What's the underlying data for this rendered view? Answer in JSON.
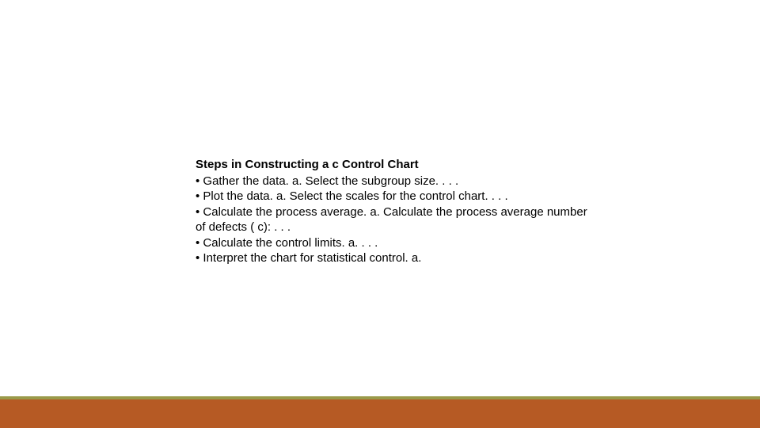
{
  "slide": {
    "title": "Steps in Constructing a c Control Chart",
    "bullets": [
      " • Gather the data. a. Select the subgroup size. . . .",
      " • Plot the data. a. Select the scales for the control chart. . . .",
      " • Calculate the process average. a. Calculate the process average number of defects ( c): . . .",
      " • Calculate the control limits. a. . . .",
      " • Interpret the chart for statistical control. a."
    ]
  }
}
